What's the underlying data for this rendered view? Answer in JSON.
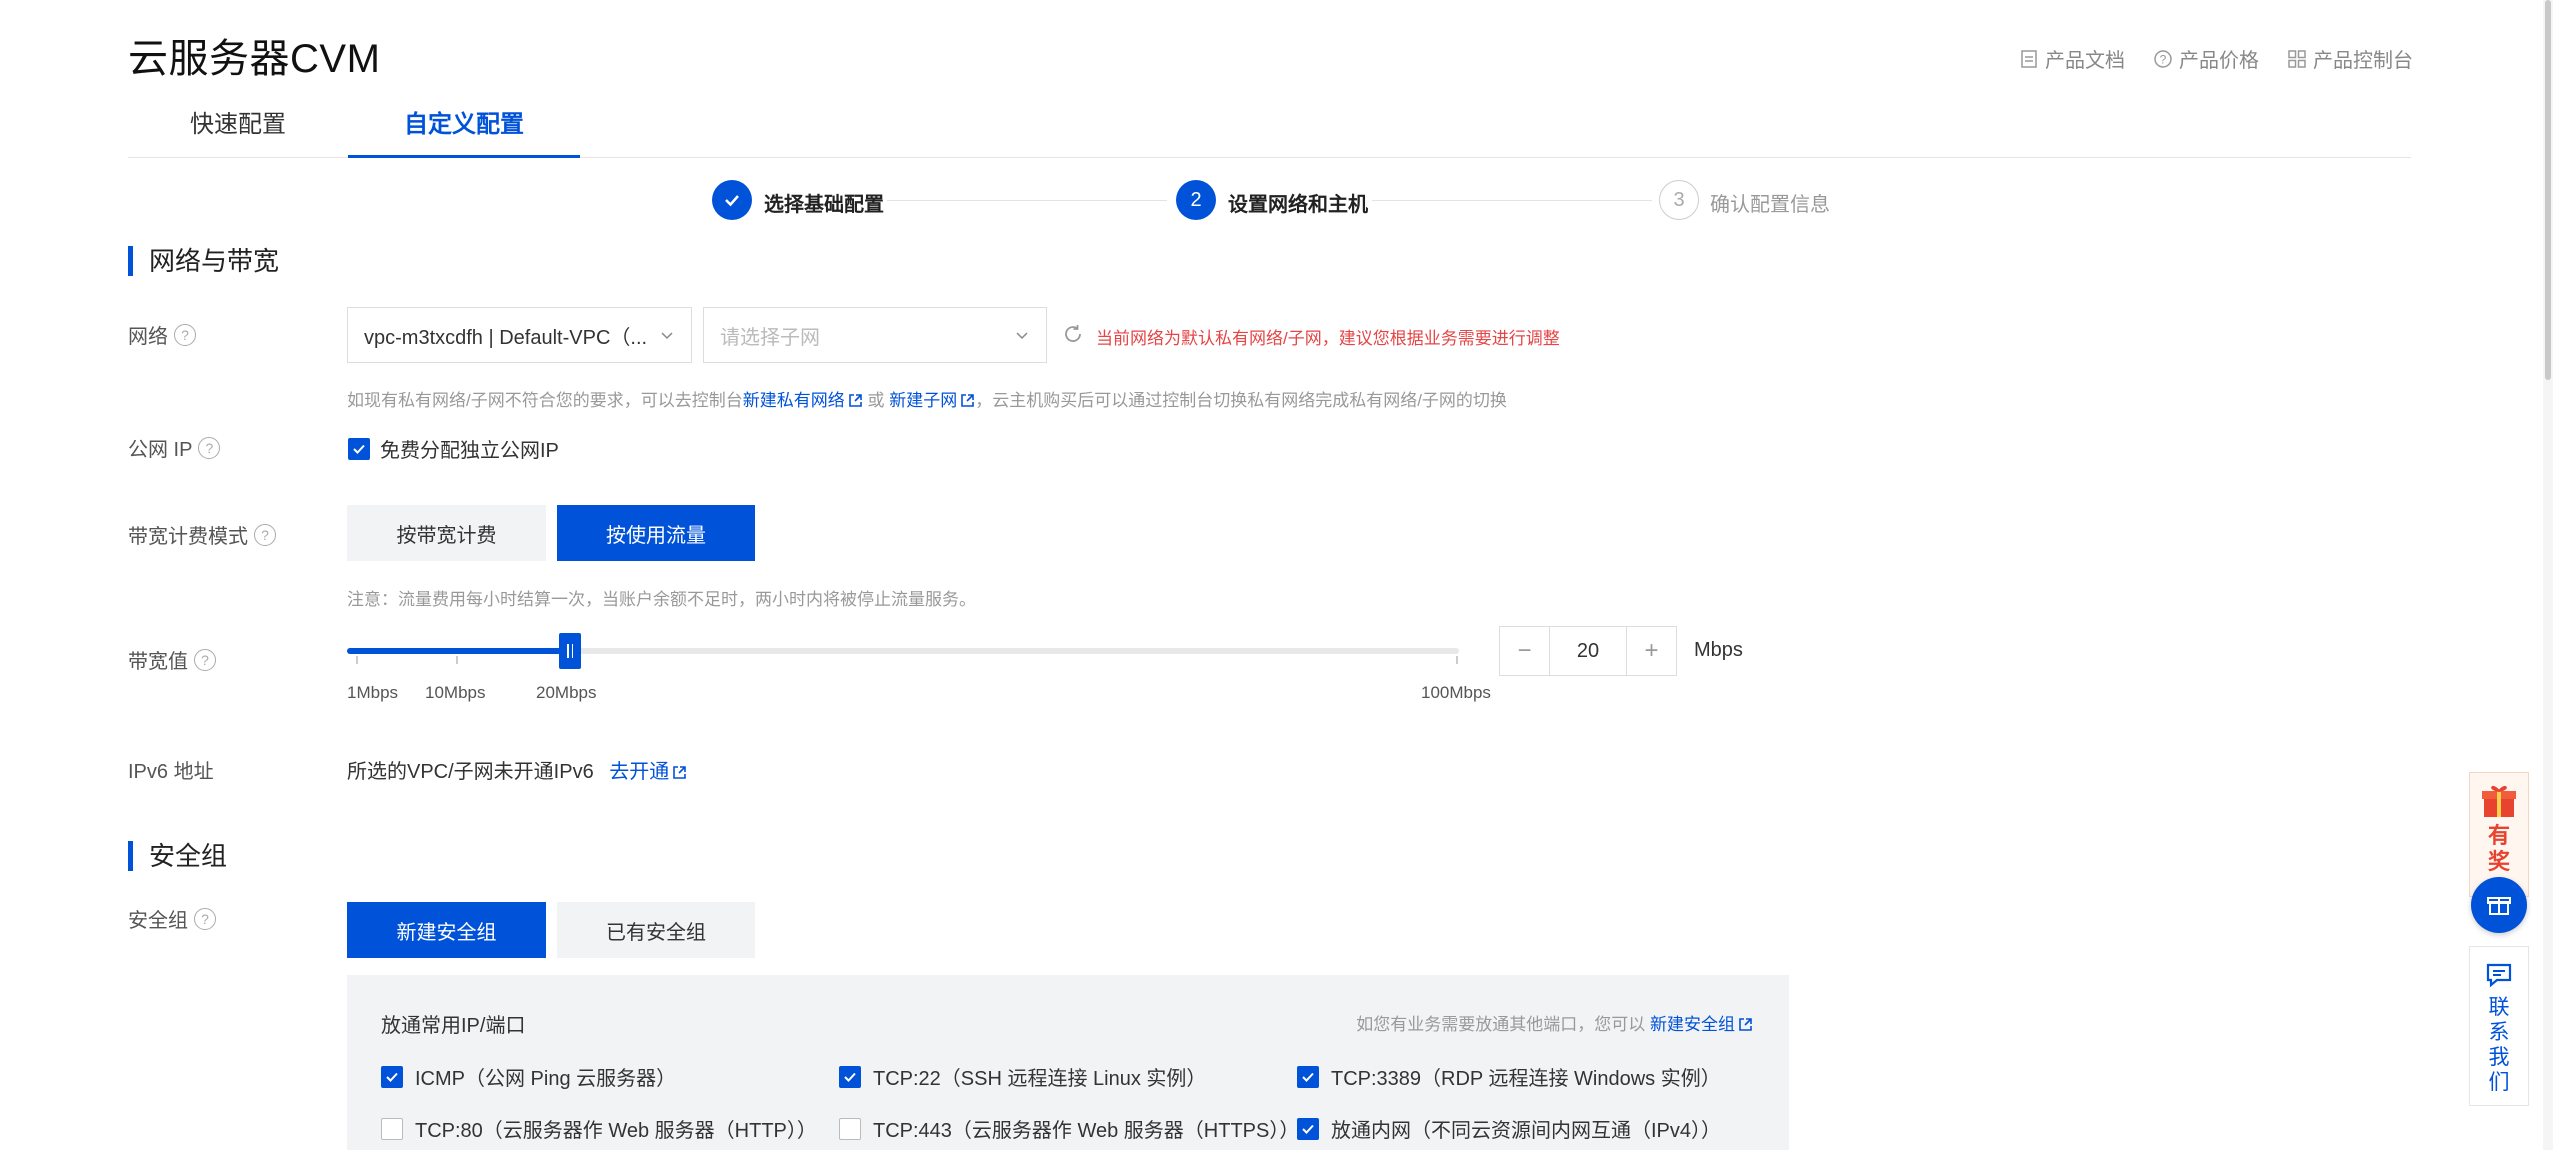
{
  "header": {
    "title": "云服务器CVM",
    "links": [
      "产品文档",
      "产品价格",
      "产品控制台"
    ]
  },
  "tabs": [
    "快速配置",
    "自定义配置"
  ],
  "steps": [
    {
      "number": "1",
      "label": "选择基础配置",
      "status": "done"
    },
    {
      "number": "2",
      "label": "设置网络和主机",
      "status": "active"
    },
    {
      "number": "3",
      "label": "确认配置信息",
      "status": "pending"
    }
  ],
  "network_section": {
    "title": "网络与带宽",
    "network_label": "网络",
    "vpc_value": "vpc-m3txcdfh | Default-VPC（...",
    "subnet_placeholder": "请选择子网",
    "network_warning": "当前网络为默认私有网络/子网，建议您根据业务需要进行调整",
    "hint_pre": "如现有私有网络/子网不符合您的要求，可以去控制台",
    "hint_link1": "新建私有网络",
    "hint_or": "或",
    "hint_link2": "新建子网",
    "hint_post": "，云主机购买后可以通过控制台切换私有网络完成私有网络/子网的切换",
    "public_ip_label": "公网 IP",
    "public_ip_checkbox": "免费分配独立公网IP",
    "public_ip_checked": true,
    "billing_label": "带宽计费模式",
    "billing_options": [
      "按带宽计费",
      "按使用流量"
    ],
    "billing_selected": "按使用流量",
    "billing_note": "注意：流量费用每小时结算一次，当账户余额不足时，两小时内将被停止流量服务。",
    "bandwidth_label": "带宽值",
    "slider_marks": [
      "1Mbps",
      "10Mbps",
      "20Mbps",
      "100Mbps"
    ],
    "slider_min": 1,
    "slider_max": 100,
    "bandwidth_value": "20",
    "bandwidth_unit": "Mbps",
    "stepper_minus": "−",
    "stepper_plus": "+",
    "ipv6_label": "IPv6 地址",
    "ipv6_text": "所选的VPC/子网未开通IPv6",
    "ipv6_link": "去开通"
  },
  "security_section": {
    "title": "安全组",
    "label": "安全组",
    "options": [
      "新建安全组",
      "已有安全组"
    ],
    "selected": "新建安全组",
    "panel_title": "放通常用IP/端口",
    "panel_hint": "如您有业务需要放通其他端口，您可以",
    "panel_hint_link": "新建安全组",
    "ports": [
      {
        "label": "ICMP（公网 Ping 云服务器）",
        "checked": true
      },
      {
        "label": "TCP:22（SSH 远程连接 Linux 实例）",
        "checked": true
      },
      {
        "label": "TCP:3389（RDP 远程连接 Windows 实例）",
        "checked": true
      },
      {
        "label": "TCP:80（云服务器作 Web 服务器（HTTP））",
        "checked": false
      },
      {
        "label": "TCP:443（云服务器作 Web 服务器（HTTPS））",
        "checked": false
      },
      {
        "label": "放通内网（不同云资源间内网互通（IPv4））",
        "checked": true
      }
    ]
  },
  "floating": {
    "reward_text": "有奖",
    "contact_text": "联系我们"
  },
  "colors": {
    "primary": "#0052d9",
    "warning": "#e54545",
    "panel_bg": "#f2f3f5"
  }
}
